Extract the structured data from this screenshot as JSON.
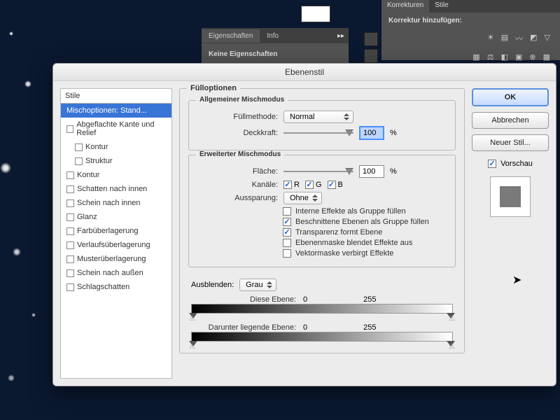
{
  "bg_panels": {
    "eigenschaften_tab": "Eigenschaften",
    "info_tab": "Info",
    "eigenschaften_body": "Keine Eigenschaften",
    "korrekturen_tab": "Korrekturen",
    "stile_tab": "Stile",
    "korrektur_hinzu": "Korrektur hinzufügen:"
  },
  "dialog": {
    "title": "Ebenenstil",
    "styles_header": "Stile",
    "styles": [
      {
        "label": "Mischoptionen: Stand...",
        "selected": true,
        "indent": false
      },
      {
        "label": "Abgeflachte Kante und Relief",
        "selected": false,
        "indent": false
      },
      {
        "label": "Kontur",
        "selected": false,
        "indent": true
      },
      {
        "label": "Struktur",
        "selected": false,
        "indent": true
      },
      {
        "label": "Kontur",
        "selected": false,
        "indent": false
      },
      {
        "label": "Schatten nach innen",
        "selected": false,
        "indent": false
      },
      {
        "label": "Schein nach innen",
        "selected": false,
        "indent": false
      },
      {
        "label": "Glanz",
        "selected": false,
        "indent": false
      },
      {
        "label": "Farbüberlagerung",
        "selected": false,
        "indent": false
      },
      {
        "label": "Verlaufsüberlagerung",
        "selected": false,
        "indent": false
      },
      {
        "label": "Musterüberlagerung",
        "selected": false,
        "indent": false
      },
      {
        "label": "Schein nach außen",
        "selected": false,
        "indent": false
      },
      {
        "label": "Schlagschatten",
        "selected": false,
        "indent": false
      }
    ],
    "fill_legend": "Fülloptionen",
    "general_legend": "Allgemeiner Mischmodus",
    "fuellmethode_lbl": "Füllmethode:",
    "fuellmethode_val": "Normal",
    "deckkraft_lbl": "Deckkraft:",
    "deckkraft_val": "100",
    "pct": "%",
    "adv_legend": "Erweiterter Mischmodus",
    "flaeche_lbl": "Fläche:",
    "flaeche_val": "100",
    "kanaele_lbl": "Kanäle:",
    "chan_r": "R",
    "chan_g": "G",
    "chan_b": "B",
    "aussparung_lbl": "Aussparung:",
    "aussparung_val": "Ohne",
    "cb1": "Interne Effekte als Gruppe füllen",
    "cb2": "Beschnittene Ebenen als Gruppe füllen",
    "cb3": "Transparenz formt Ebene",
    "cb4": "Ebenenmaske blendet Effekte aus",
    "cb5": "Vektormaske verbirgt Effekte",
    "ausblenden_lbl": "Ausblenden:",
    "ausblenden_val": "Grau",
    "diese_ebene_lbl": "Diese Ebene:",
    "darunter_lbl": "Darunter liegende Ebene:",
    "range_lo": "0",
    "range_hi": "255",
    "btn_ok": "OK",
    "btn_cancel": "Abbrechen",
    "btn_newstyle": "Neuer Stil...",
    "preview_lbl": "Vorschau"
  }
}
